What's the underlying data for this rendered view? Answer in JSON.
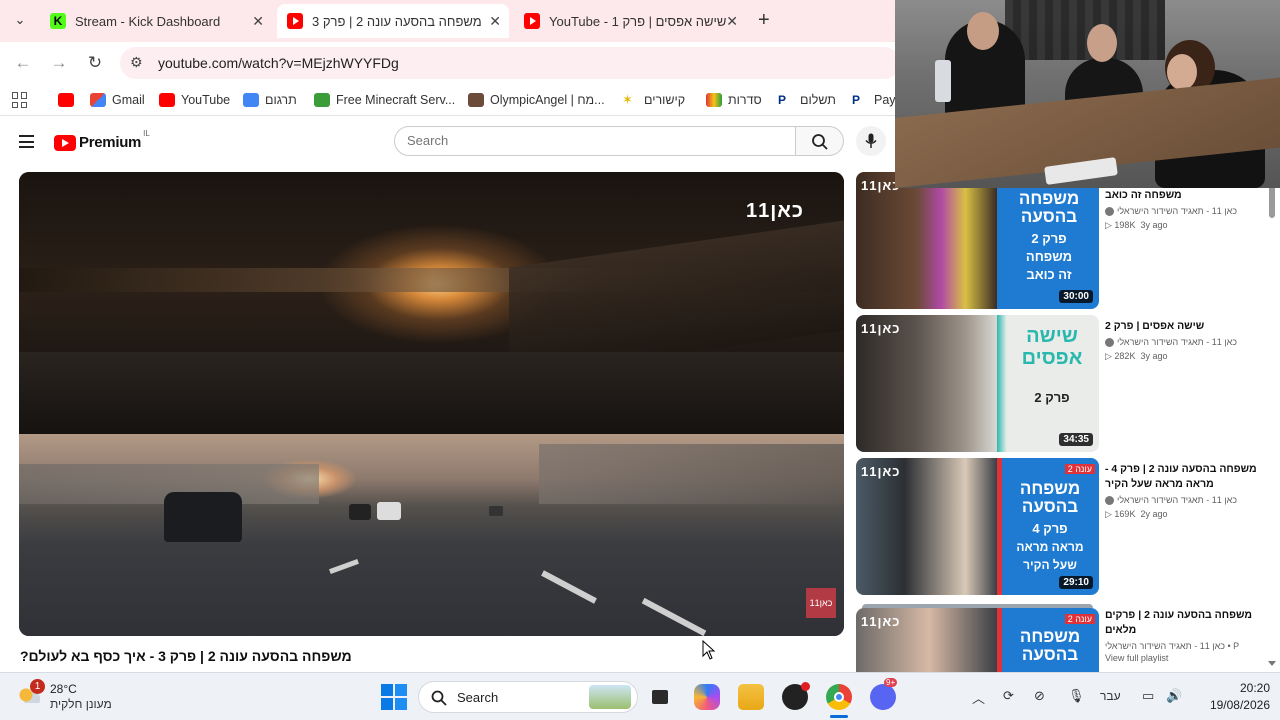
{
  "browser": {
    "tabs": [
      {
        "label": "Stream - Kick Dashboard",
        "favicon": "kick-icon",
        "active": false
      },
      {
        "label": "משפחה בהסעה עונה 2 | פרק 3",
        "favicon": "youtube-icon",
        "active": true
      },
      {
        "label": "YouTube - 1 שישה אפסים | פרק",
        "favicon": "youtube-icon",
        "active": false
      }
    ],
    "new_tab_glyph": "+",
    "url": "youtube.com/watch?v=MEjzhWYYFDg",
    "bookmarks": [
      {
        "label": "",
        "icon": "youtube-icon"
      },
      {
        "label": "Gmail",
        "icon": "gmail-icon"
      },
      {
        "label": "YouTube",
        "icon": "youtube-icon"
      },
      {
        "label": "תרגום",
        "icon": "translate-icon"
      },
      {
        "label": "Free Minecraft Serv...",
        "icon": "minecraft-icon"
      },
      {
        "label": "OlympicAngel | מח...",
        "icon": "avatar-icon"
      },
      {
        "label": "קישורים",
        "icon": "star-icon"
      },
      {
        "label": "סדרות",
        "icon": "tv-icon"
      },
      {
        "label": "תשלום",
        "icon": "paypal-icon"
      },
      {
        "label": "PayP",
        "icon": "paypal-icon"
      }
    ]
  },
  "youtube": {
    "logo_text": "Premium",
    "logo_country": "IL",
    "search_placeholder": "Search",
    "video": {
      "title": "משפחה בהסעה עונה 2 | פרק 3 - איך כסף בא לעולם?",
      "channel_watermark": "כאן11",
      "corner_logo": "כאן11"
    },
    "recommendations": [
      {
        "title": "משפחה זה כואב",
        "channel": "כאן 11 - תאגיד השידור הישראלי",
        "views": "198K",
        "age": "3y ago",
        "duration": "30:00",
        "thumb_logo": "כאן11",
        "thumb_lines": [
          "משפחה",
          "בהסעה",
          "פרק 2",
          "משפחה",
          "זה כואב"
        ],
        "season_badge": ""
      },
      {
        "title": "שישה אפסים | פרק 2",
        "channel": "כאן 11 - תאגיד השידור הישראלי",
        "views": "282K",
        "age": "3y ago",
        "duration": "34:35",
        "thumb_logo": "כאן11",
        "thumb_lines": [
          "שישה",
          "אפסים",
          "פרק 2"
        ],
        "season_badge": ""
      },
      {
        "title": "משפחה בהסעה עונה 2 | פרק 4 - מראה מראה שעל הקיר",
        "channel": "כאן 11 - תאגיד השידור הישראלי",
        "views": "169K",
        "age": "2y ago",
        "duration": "29:10",
        "thumb_logo": "כאן11",
        "thumb_lines": [
          "משפחה",
          "בהסעה",
          "פרק 4",
          "מראה מראה",
          "שעל הקיר"
        ],
        "season_badge": "עונה 2"
      },
      {
        "title": "משפחה בהסעה עונה 2 | פרקים מלאים",
        "channel": "כאן 11 - תאגיד השידור הישראלי • P",
        "views": "",
        "age": "",
        "duration": "",
        "playlist_link": "View full playlist",
        "thumb_logo": "כאן11",
        "thumb_lines": [
          "משפחה",
          "בהסעה"
        ],
        "season_badge": "עונה 2"
      }
    ]
  },
  "taskbar": {
    "weather_temp": "28°C",
    "weather_desc": "מעונן חלקית",
    "weather_badge": "1",
    "search_label": "Search",
    "discord_badge": "9+",
    "language": "עבר",
    "time": "20:20",
    "date": "19/08/2026"
  },
  "colors": {
    "youtube_red": "#ff0000",
    "tab_strip": "#fde8ec",
    "kan_blue": "#1e7bd1",
    "kan_red": "#e03238"
  }
}
